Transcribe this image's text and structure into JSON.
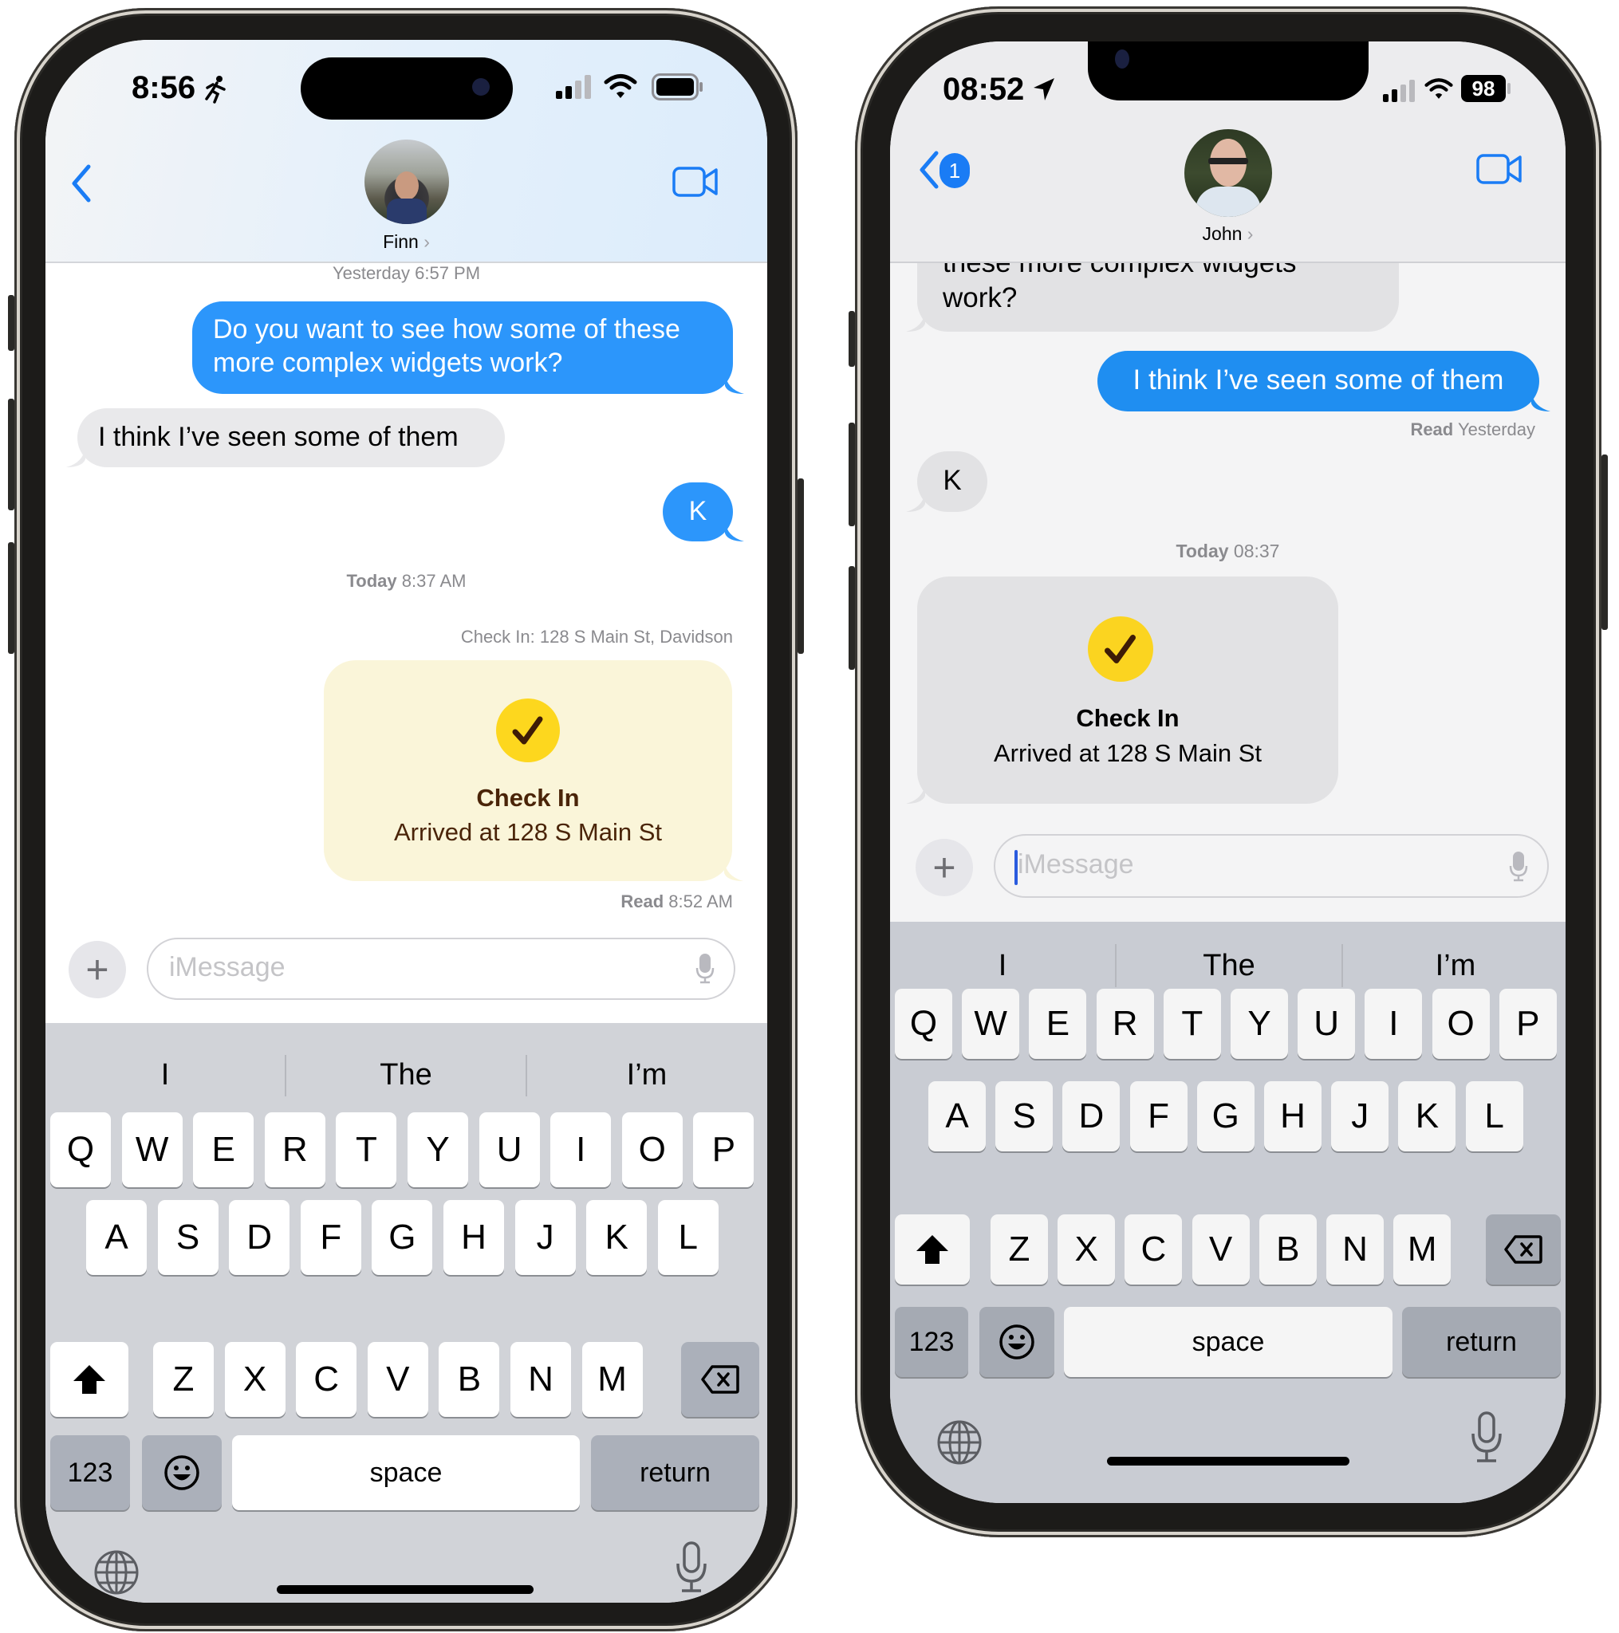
{
  "left_phone": {
    "status": {
      "time": "8:56",
      "activity_icon": "running-figure-icon",
      "signal_icon": "cellular-signal-icon",
      "wifi_icon": "wifi-icon",
      "battery_icon": "battery-icon"
    },
    "header": {
      "back_icon": "chevron-left-icon",
      "contact_name": "Finn",
      "contact_chevron": "›",
      "video_icon": "video-camera-icon"
    },
    "messages": [
      {
        "type": "timestamp",
        "text_bold": "Yesterday",
        "text": "6:57 PM"
      },
      {
        "type": "sent",
        "text": "Do you want to see how some of these more complex widgets work?"
      },
      {
        "type": "received",
        "text": "I think I’ve seen some of them"
      },
      {
        "type": "sent",
        "text": "K"
      },
      {
        "type": "timestamp",
        "text_bold": "Today",
        "text": "8:37 AM"
      },
      {
        "type": "label",
        "text": "Check In: 128 S Main St, Davidson"
      },
      {
        "type": "checkin",
        "title": "Check In",
        "subtitle": "Arrived at 128 S Main St"
      },
      {
        "type": "receipt",
        "text_bold": "Read",
        "text": "8:52 AM"
      }
    ],
    "composer": {
      "plus_label": "+",
      "placeholder": "iMessage"
    },
    "keyboard": {
      "suggestions": [
        "I",
        "The",
        "I’m"
      ],
      "row1": [
        "Q",
        "W",
        "E",
        "R",
        "T",
        "Y",
        "U",
        "I",
        "O",
        "P"
      ],
      "row2": [
        "A",
        "S",
        "D",
        "F",
        "G",
        "H",
        "J",
        "K",
        "L"
      ],
      "row3": [
        "Z",
        "X",
        "C",
        "V",
        "B",
        "N",
        "M"
      ],
      "numbers_label": "123",
      "space_label": "space",
      "return_label": "return"
    },
    "colors": {
      "sent_bubble": "#2c96fb",
      "received_bubble": "#e9e9eb",
      "checkin_bubble": "#faf5d9",
      "checkin_icon": "#fdd71e",
      "checkin_text": "#4a2408",
      "accent": "#1a7cf5"
    }
  },
  "right_phone": {
    "status": {
      "time": "08:52",
      "location_icon": "location-arrow-icon",
      "signal_icon": "cellular-signal-icon",
      "wifi_icon": "wifi-icon",
      "battery_percent": "98"
    },
    "header": {
      "back_icon": "chevron-left-icon",
      "unread_badge": "1",
      "contact_name": "John",
      "contact_chevron": "›",
      "video_icon": "video-camera-icon"
    },
    "messages": [
      {
        "type": "received",
        "text": "these more complex widgets work?"
      },
      {
        "type": "sent",
        "text": "I think I’ve seen some of them"
      },
      {
        "type": "receipt",
        "text_bold": "Read",
        "text": "Yesterday"
      },
      {
        "type": "received",
        "text": "K"
      },
      {
        "type": "timestamp",
        "text_bold": "Today",
        "text": "08:37"
      },
      {
        "type": "checkin",
        "title": "Check In",
        "subtitle": "Arrived at 128 S Main St"
      }
    ],
    "composer": {
      "plus_label": "+",
      "placeholder": "iMessage"
    },
    "keyboard": {
      "suggestions": [
        "I",
        "The",
        "I’m"
      ],
      "row1": [
        "Q",
        "W",
        "E",
        "R",
        "T",
        "Y",
        "U",
        "I",
        "O",
        "P"
      ],
      "row2": [
        "A",
        "S",
        "D",
        "F",
        "G",
        "H",
        "J",
        "K",
        "L"
      ],
      "row3": [
        "Z",
        "X",
        "C",
        "V",
        "B",
        "N",
        "M"
      ],
      "numbers_label": "123",
      "space_label": "space",
      "return_label": "return"
    },
    "colors": {
      "sent_bubble": "#1f8ef1",
      "received_bubble": "#e2e2e4",
      "checkin_bubble": "#e2e2e4",
      "checkin_icon": "#fbd420",
      "accent": "#1a7cf5"
    }
  }
}
